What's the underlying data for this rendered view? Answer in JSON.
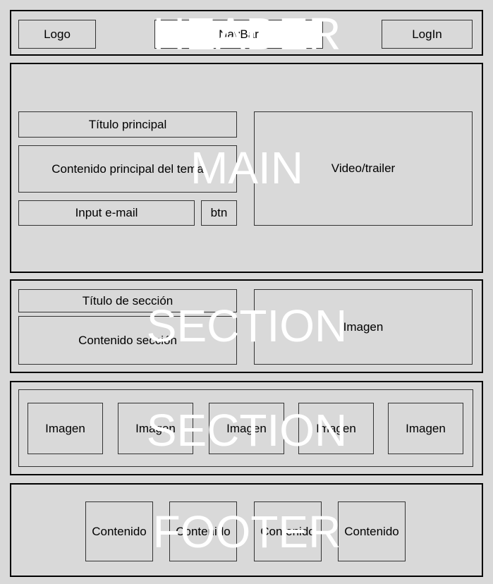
{
  "header": {
    "big_label": "HEADER",
    "logo": "Logo",
    "navbar": "NavBar",
    "login": "LogIn"
  },
  "main": {
    "big_label": "MAIN",
    "title": "Título principal",
    "content": "Contenido principal del tema",
    "email_input": "Input e-mail",
    "button": "btn",
    "video": "Video/trailer"
  },
  "section1": {
    "big_label": "SECTION",
    "title": "Título de sección",
    "content": "Contenido sección",
    "image": "Imagen"
  },
  "section2": {
    "big_label": "SECTION",
    "images": [
      "Imagen",
      "Imagen",
      "Imagen",
      "Imagen",
      "Imagen"
    ]
  },
  "footer": {
    "big_label": "FOOTER",
    "items": [
      "Contenido",
      "Contenido",
      "Contenido",
      "Contenido"
    ]
  },
  "colors": {
    "background": "#d9d9d9",
    "border": "#000000",
    "overlay_text": "#ffffff"
  }
}
